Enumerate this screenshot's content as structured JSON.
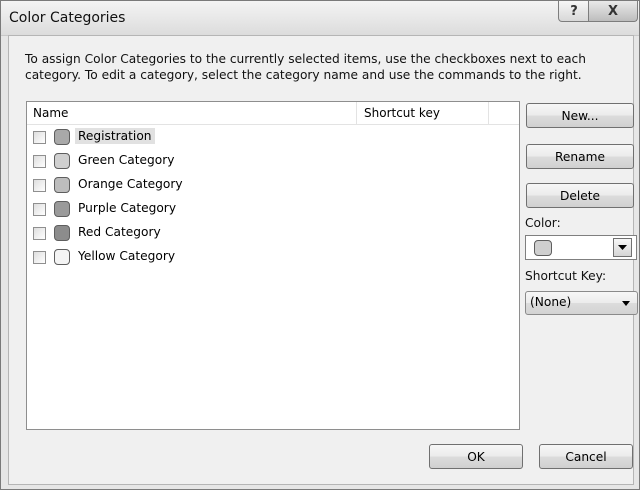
{
  "window": {
    "title": "Color Categories"
  },
  "titlebar": {
    "help_glyph": "?",
    "close_glyph": "X"
  },
  "instructions": "To assign Color Categories to the currently selected items, use the checkboxes next to each category.  To edit a category, select the category name and use the commands to the right.",
  "list": {
    "columns": {
      "name": "Name",
      "shortcut": "Shortcut key"
    },
    "items": [
      {
        "label": "Registration",
        "swatch_color": "#a9a9a9",
        "checked": false,
        "selected": true
      },
      {
        "label": "Green Category",
        "swatch_color": "#d0d0d0",
        "checked": false,
        "selected": false
      },
      {
        "label": "Orange Category",
        "swatch_color": "#bdbdbd",
        "checked": false,
        "selected": false
      },
      {
        "label": "Purple Category",
        "swatch_color": "#9a9a9a",
        "checked": false,
        "selected": false
      },
      {
        "label": "Red Category",
        "swatch_color": "#8c8c8c",
        "checked": false,
        "selected": false
      },
      {
        "label": "Yellow Category",
        "swatch_color": "#f4f4f4",
        "checked": false,
        "selected": false
      }
    ]
  },
  "buttons": {
    "new": "New...",
    "rename": "Rename",
    "delete": "Delete",
    "ok": "OK",
    "cancel": "Cancel"
  },
  "color": {
    "label": "Color:",
    "current_color": "#cfcfcf"
  },
  "shortcut": {
    "label": "Shortcut Key:",
    "value": "(None)"
  }
}
